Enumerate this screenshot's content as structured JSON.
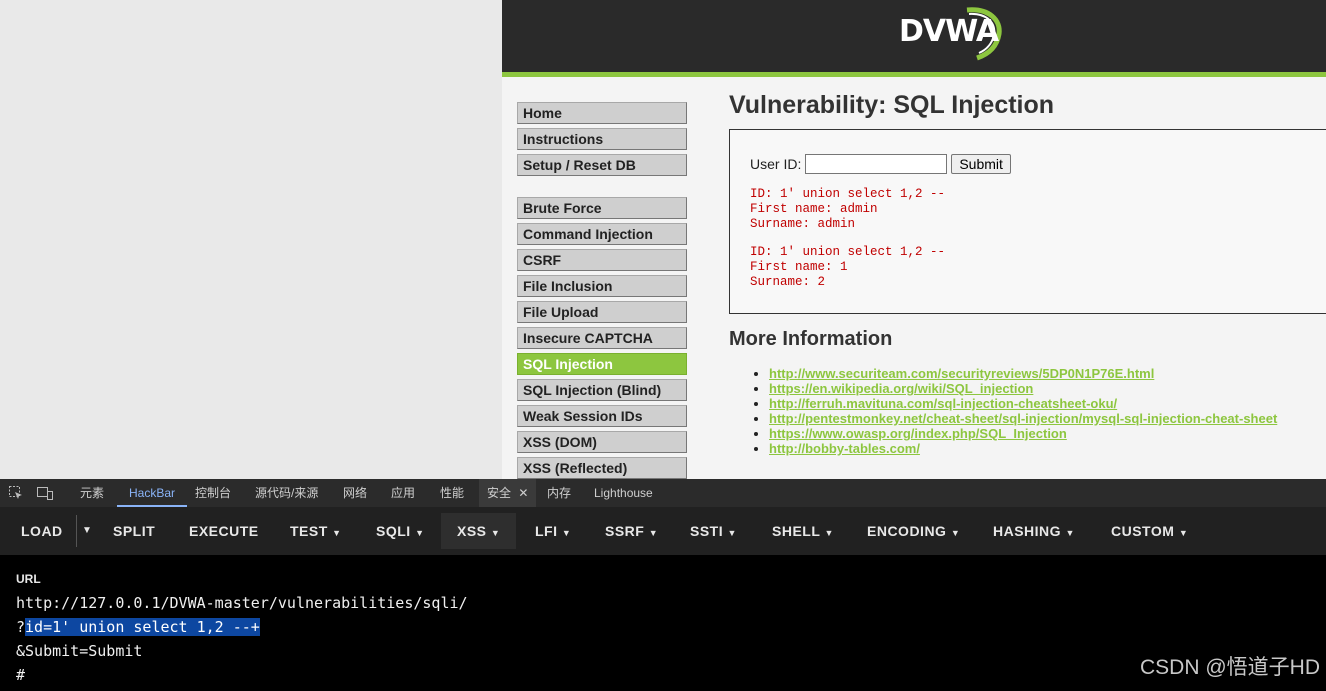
{
  "dvwa": {
    "logo_text": "DVWA",
    "menu_group1": [
      "Home",
      "Instructions",
      "Setup / Reset DB"
    ],
    "menu_group2": [
      "Brute Force",
      "Command Injection",
      "CSRF",
      "File Inclusion",
      "File Upload",
      "Insecure CAPTCHA",
      "SQL Injection",
      "SQL Injection (Blind)",
      "Weak Session IDs",
      "XSS (DOM)",
      "XSS (Reflected)"
    ],
    "active_item": "SQL Injection",
    "page_title": "Vulnerability: SQL Injection",
    "form": {
      "label": "User ID:",
      "input_value": "",
      "submit_label": "Submit"
    },
    "results": [
      {
        "id": "ID: 1' union select 1,2 --",
        "first": "First name: admin",
        "surname": "Surname: admin"
      },
      {
        "id": "ID: 1' union select 1,2 --",
        "first": "First name: 1",
        "surname": "Surname: 2"
      }
    ],
    "more_info_title": "More Information",
    "links": [
      "http://www.securiteam.com/securityreviews/5DP0N1P76E.html",
      "https://en.wikipedia.org/wiki/SQL_injection",
      "http://ferruh.mavituna.com/sql-injection-cheatsheet-oku/",
      "http://pentestmonkey.net/cheat-sheet/sql-injection/mysql-sql-injection-cheat-sheet",
      "https://www.owasp.org/index.php/SQL_Injection",
      "http://bobby-tables.com/"
    ],
    "colors": {
      "accent": "#8dc63f",
      "header": "#2a2a2a",
      "result_text": "#c00000"
    }
  },
  "devtools": {
    "tabs": [
      "元素",
      "HackBar",
      "控制台",
      "源代码/来源",
      "网络",
      "应用",
      "性能",
      "安全",
      "内存",
      "Lighthouse"
    ],
    "active_tab": "HackBar",
    "close_icon": "close-icon"
  },
  "hackbar": {
    "buttons": [
      "LOAD",
      "SPLIT",
      "EXECUTE",
      "TEST",
      "SQLI",
      "XSS",
      "LFI",
      "SSRF",
      "SSTI",
      "SHELL",
      "ENCODING",
      "HASHING",
      "CUSTOM"
    ],
    "selected_button": "XSS",
    "url_label": "URL",
    "url_lines": {
      "line1": "http://127.0.0.1/DVWA-master/vulnerabilities/sqli/",
      "line2_prefix": "?",
      "line2_selected": "id=1' union select 1,2 --+",
      "line3": "&Submit=Submit",
      "line4": "#"
    }
  },
  "watermark": "CSDN @悟道子HD"
}
